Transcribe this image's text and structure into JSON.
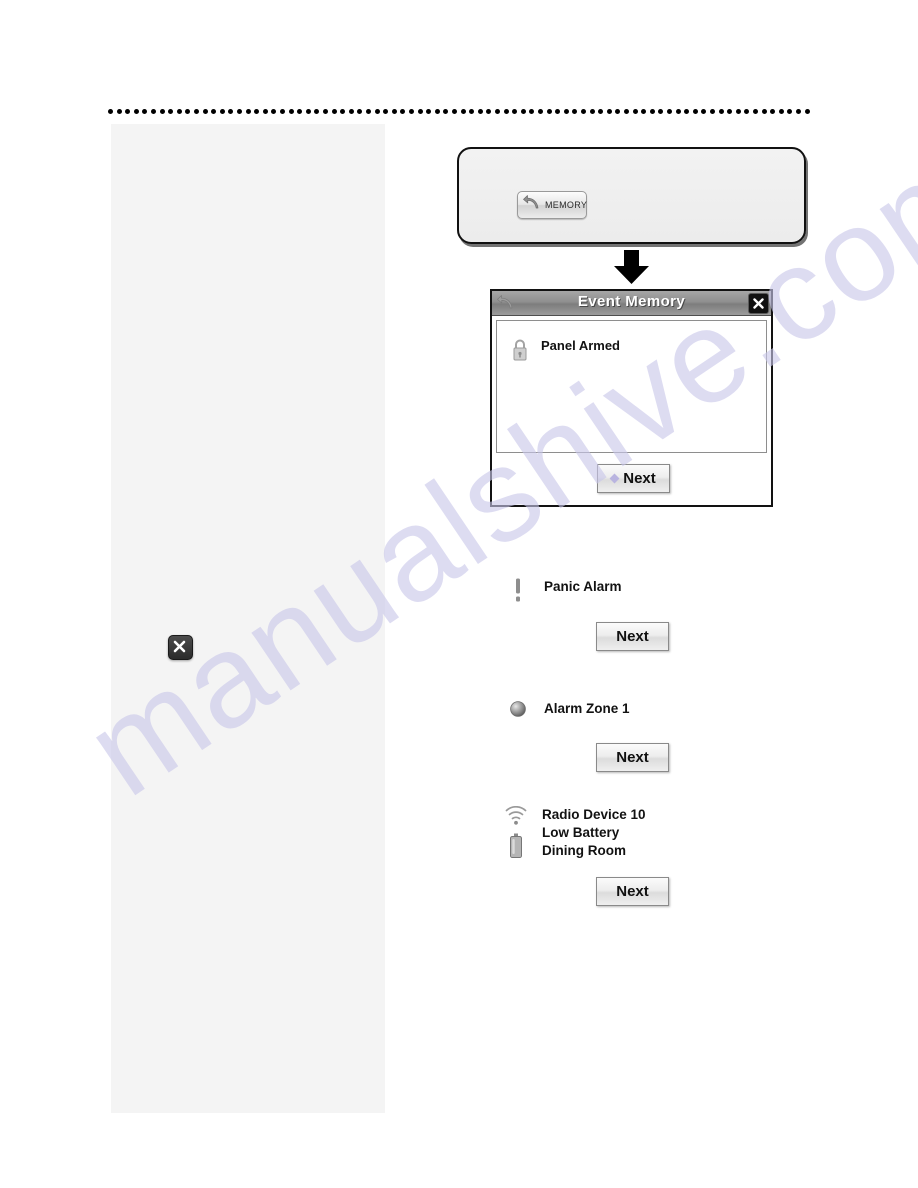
{
  "page": {
    "background_color": "#ffffff",
    "watermark_text": "manualshive.com",
    "watermark_color": "#c9c7ea"
  },
  "left_panel": {
    "background_color": "#f4f4f4",
    "close_badge_icon": "close-x-icon"
  },
  "memory_callout": {
    "button": {
      "icon": "back-arrow-icon",
      "label": "MEMORY"
    }
  },
  "flow_arrow": {
    "icon": "down-arrow-icon"
  },
  "event_dialog": {
    "title": "Event Memory",
    "back_icon": "back-arrow-icon",
    "close_icon": "close-x-icon",
    "entry": {
      "icon": "padlock-icon",
      "label": "Panel Armed"
    },
    "next_label": "Next"
  },
  "event_steps": [
    {
      "icons": [
        "exclamation-icon"
      ],
      "lines": [
        "Panic Alarm"
      ],
      "next_label": "Next"
    },
    {
      "icons": [
        "sphere-sensor-icon"
      ],
      "lines": [
        "Alarm Zone 1"
      ],
      "next_label": "Next"
    },
    {
      "icons": [
        "radio-signal-icon",
        "battery-icon"
      ],
      "lines": [
        "Radio Device 10",
        "Low Battery",
        "Dining Room"
      ],
      "next_label": "Next"
    }
  ]
}
